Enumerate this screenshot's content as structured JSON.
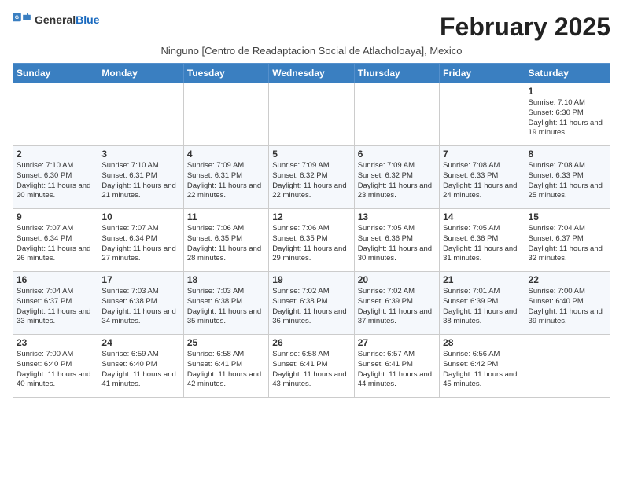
{
  "logo": {
    "text_general": "General",
    "text_blue": "Blue"
  },
  "title": "February 2025",
  "subtitle": "Ninguno [Centro de Readaptacion Social de Atlacholoaya], Mexico",
  "days_of_week": [
    "Sunday",
    "Monday",
    "Tuesday",
    "Wednesday",
    "Thursday",
    "Friday",
    "Saturday"
  ],
  "weeks": [
    [
      {
        "day": "",
        "info": ""
      },
      {
        "day": "",
        "info": ""
      },
      {
        "day": "",
        "info": ""
      },
      {
        "day": "",
        "info": ""
      },
      {
        "day": "",
        "info": ""
      },
      {
        "day": "",
        "info": ""
      },
      {
        "day": "1",
        "info": "Sunrise: 7:10 AM\nSunset: 6:30 PM\nDaylight: 11 hours and 19 minutes."
      }
    ],
    [
      {
        "day": "2",
        "info": "Sunrise: 7:10 AM\nSunset: 6:30 PM\nDaylight: 11 hours and 20 minutes."
      },
      {
        "day": "3",
        "info": "Sunrise: 7:10 AM\nSunset: 6:31 PM\nDaylight: 11 hours and 21 minutes."
      },
      {
        "day": "4",
        "info": "Sunrise: 7:09 AM\nSunset: 6:31 PM\nDaylight: 11 hours and 22 minutes."
      },
      {
        "day": "5",
        "info": "Sunrise: 7:09 AM\nSunset: 6:32 PM\nDaylight: 11 hours and 22 minutes."
      },
      {
        "day": "6",
        "info": "Sunrise: 7:09 AM\nSunset: 6:32 PM\nDaylight: 11 hours and 23 minutes."
      },
      {
        "day": "7",
        "info": "Sunrise: 7:08 AM\nSunset: 6:33 PM\nDaylight: 11 hours and 24 minutes."
      },
      {
        "day": "8",
        "info": "Sunrise: 7:08 AM\nSunset: 6:33 PM\nDaylight: 11 hours and 25 minutes."
      }
    ],
    [
      {
        "day": "9",
        "info": "Sunrise: 7:07 AM\nSunset: 6:34 PM\nDaylight: 11 hours and 26 minutes."
      },
      {
        "day": "10",
        "info": "Sunrise: 7:07 AM\nSunset: 6:34 PM\nDaylight: 11 hours and 27 minutes."
      },
      {
        "day": "11",
        "info": "Sunrise: 7:06 AM\nSunset: 6:35 PM\nDaylight: 11 hours and 28 minutes."
      },
      {
        "day": "12",
        "info": "Sunrise: 7:06 AM\nSunset: 6:35 PM\nDaylight: 11 hours and 29 minutes."
      },
      {
        "day": "13",
        "info": "Sunrise: 7:05 AM\nSunset: 6:36 PM\nDaylight: 11 hours and 30 minutes."
      },
      {
        "day": "14",
        "info": "Sunrise: 7:05 AM\nSunset: 6:36 PM\nDaylight: 11 hours and 31 minutes."
      },
      {
        "day": "15",
        "info": "Sunrise: 7:04 AM\nSunset: 6:37 PM\nDaylight: 11 hours and 32 minutes."
      }
    ],
    [
      {
        "day": "16",
        "info": "Sunrise: 7:04 AM\nSunset: 6:37 PM\nDaylight: 11 hours and 33 minutes."
      },
      {
        "day": "17",
        "info": "Sunrise: 7:03 AM\nSunset: 6:38 PM\nDaylight: 11 hours and 34 minutes."
      },
      {
        "day": "18",
        "info": "Sunrise: 7:03 AM\nSunset: 6:38 PM\nDaylight: 11 hours and 35 minutes."
      },
      {
        "day": "19",
        "info": "Sunrise: 7:02 AM\nSunset: 6:38 PM\nDaylight: 11 hours and 36 minutes."
      },
      {
        "day": "20",
        "info": "Sunrise: 7:02 AM\nSunset: 6:39 PM\nDaylight: 11 hours and 37 minutes."
      },
      {
        "day": "21",
        "info": "Sunrise: 7:01 AM\nSunset: 6:39 PM\nDaylight: 11 hours and 38 minutes."
      },
      {
        "day": "22",
        "info": "Sunrise: 7:00 AM\nSunset: 6:40 PM\nDaylight: 11 hours and 39 minutes."
      }
    ],
    [
      {
        "day": "23",
        "info": "Sunrise: 7:00 AM\nSunset: 6:40 PM\nDaylight: 11 hours and 40 minutes."
      },
      {
        "day": "24",
        "info": "Sunrise: 6:59 AM\nSunset: 6:40 PM\nDaylight: 11 hours and 41 minutes."
      },
      {
        "day": "25",
        "info": "Sunrise: 6:58 AM\nSunset: 6:41 PM\nDaylight: 11 hours and 42 minutes."
      },
      {
        "day": "26",
        "info": "Sunrise: 6:58 AM\nSunset: 6:41 PM\nDaylight: 11 hours and 43 minutes."
      },
      {
        "day": "27",
        "info": "Sunrise: 6:57 AM\nSunset: 6:41 PM\nDaylight: 11 hours and 44 minutes."
      },
      {
        "day": "28",
        "info": "Sunrise: 6:56 AM\nSunset: 6:42 PM\nDaylight: 11 hours and 45 minutes."
      },
      {
        "day": "",
        "info": ""
      }
    ]
  ]
}
